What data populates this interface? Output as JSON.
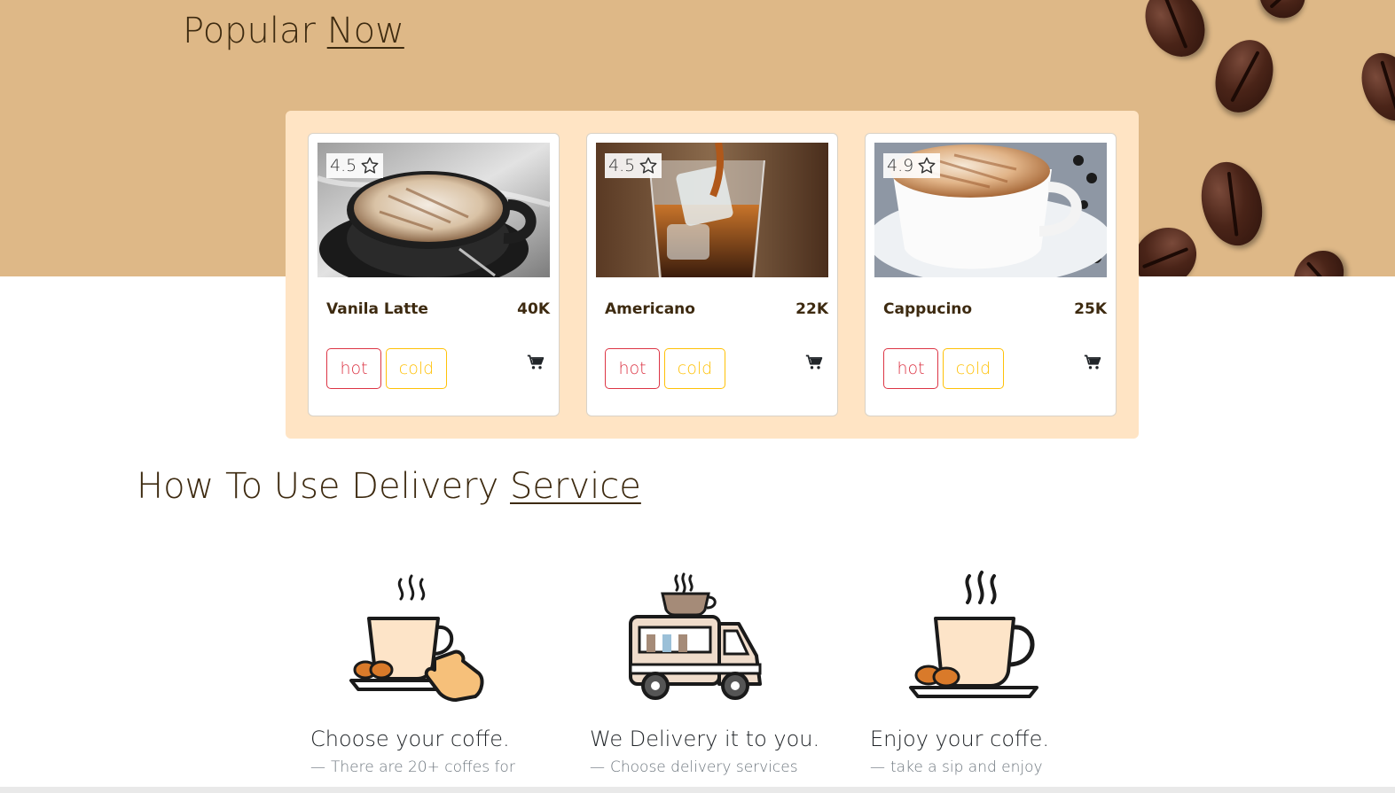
{
  "popular": {
    "title_prefix": "Popular",
    "title_highlight": "Now",
    "cards": [
      {
        "rating": "4.5",
        "name": "Vanila Latte",
        "price": "40K",
        "hot_label": "hot",
        "cold_label": "cold"
      },
      {
        "rating": "4.5",
        "name": "Americano",
        "price": "22K",
        "hot_label": "hot",
        "cold_label": "cold"
      },
      {
        "rating": "4.9",
        "name": "Cappucino",
        "price": "25K",
        "hot_label": "hot",
        "cold_label": "cold"
      }
    ]
  },
  "delivery": {
    "title_prefix": "How To Use Delivery",
    "title_highlight": "Service",
    "steps": [
      {
        "icon": "coffee-cup-hand-icon",
        "title": "Choose your coffe.",
        "subtitle": "There are 20+ coffes for"
      },
      {
        "icon": "delivery-truck-icon",
        "title": "We Delivery it to you.",
        "subtitle": "Choose delivery services"
      },
      {
        "icon": "coffee-cup-beans-icon",
        "title": "Enjoy your coffe.",
        "subtitle": "take a sip and enjoy"
      }
    ]
  },
  "colors": {
    "hero_band": "#deb887",
    "cards_panel": "#ffe4c4",
    "hot": "#dc3545",
    "cold": "#ffc107",
    "text_brown": "#3d2a10"
  }
}
